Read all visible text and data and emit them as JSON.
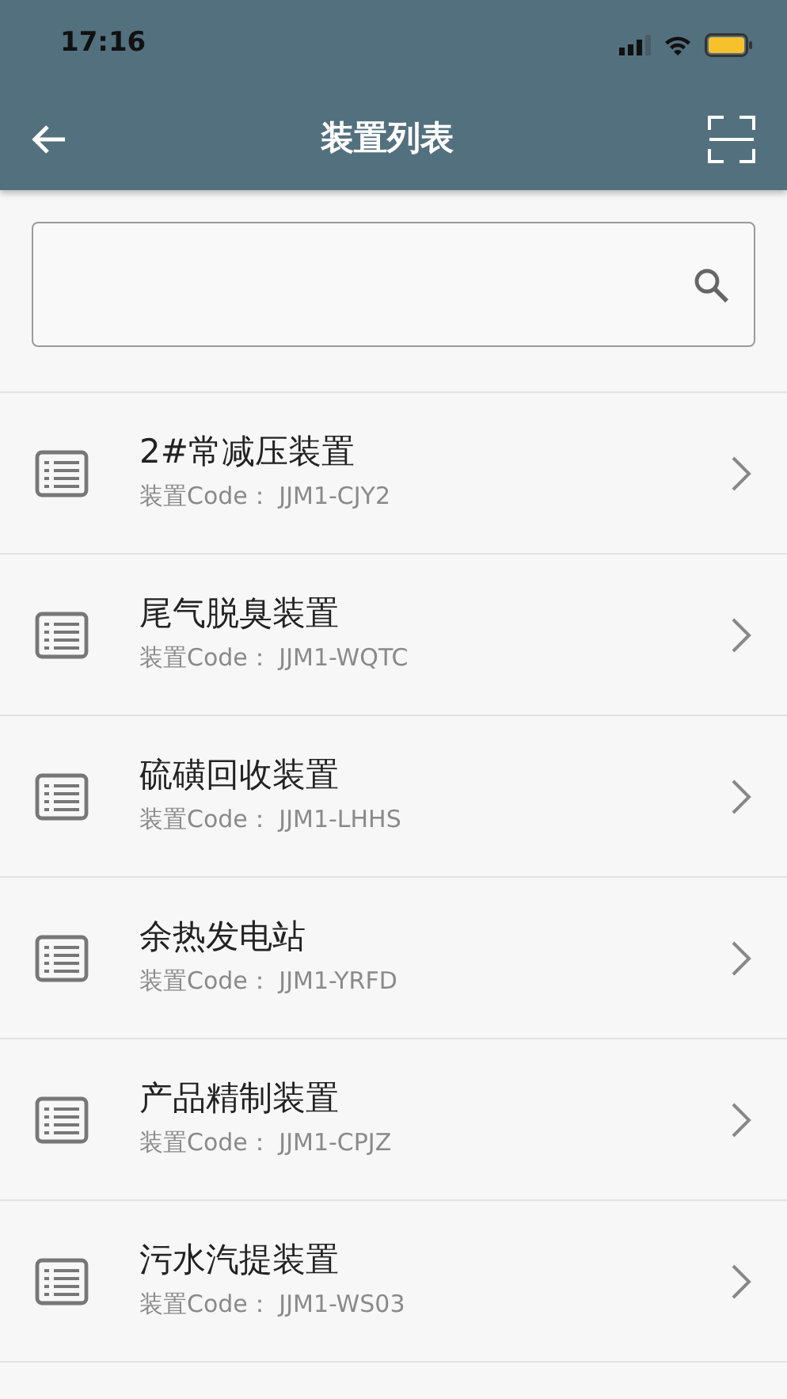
{
  "status_bar": {
    "time": "17:16"
  },
  "header": {
    "title": "装置列表"
  },
  "devices": [
    {
      "name": "2#常减压装置",
      "code": "装置Code： JJM1-CJY2"
    },
    {
      "name": "尾气脱臭装置",
      "code": "装置Code： JJM1-WQTC"
    },
    {
      "name": "硫磺回收装置",
      "code": "装置Code： JJM1-LHHS"
    },
    {
      "name": "余热发电站",
      "code": "装置Code： JJM1-YRFD"
    },
    {
      "name": "产品精制装置",
      "code": "装置Code： JJM1-CPJZ"
    },
    {
      "name": "污水汽提装置",
      "code": "装置Code： JJM1-WS03"
    }
  ]
}
